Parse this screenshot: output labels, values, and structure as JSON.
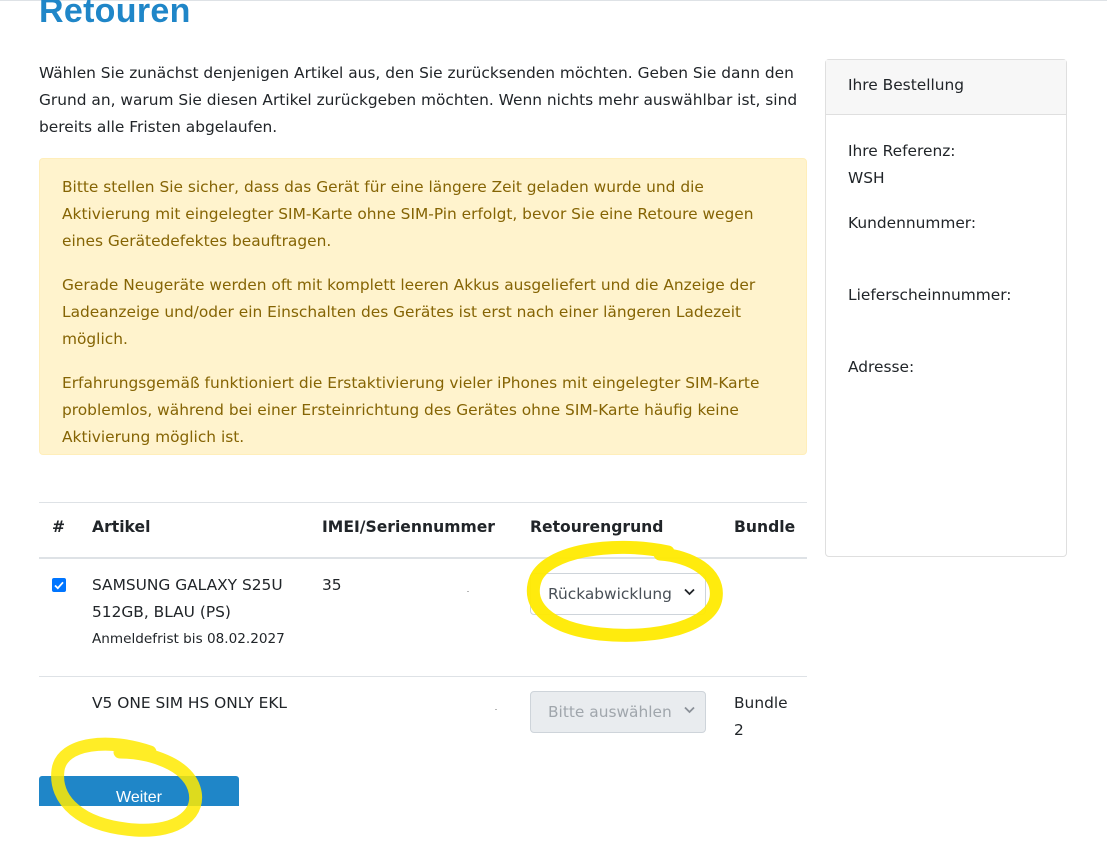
{
  "page": {
    "title": "Retouren",
    "intro": "Wählen Sie zunächst denjenigen Artikel aus, den Sie zurücksenden möchten. Geben Sie dann den Grund an, warum Sie diesen Artikel zurückgeben möchten. Wenn nichts mehr auswählbar ist, sind bereits alle Fristen abgelaufen."
  },
  "notice": {
    "paragraphs": [
      "Bitte stellen Sie sicher, dass das Gerät für eine längere Zeit geladen wurde und die Aktivierung mit eingelegter SIM-Karte ohne SIM-Pin erfolgt, bevor Sie eine Retoure wegen eines Gerätedefektes beauftragen.",
      "Gerade Neugeräte werden oft mit komplett leeren Akkus ausgeliefert und die Anzeige der Ladeanzeige und/oder ein Einschalten des Gerätes ist erst nach einer längeren Ladezeit möglich.",
      "Erfahrungsgemäß funktioniert die Erstaktivierung vieler iPhones mit eingelegter SIM-Karte problemlos, während bei einer Ersteinrichtung des Gerätes ohne SIM-Karte häufig keine Aktivierung möglich ist."
    ]
  },
  "table": {
    "headers": [
      "#",
      "Artikel",
      "IMEI/Seriennummer",
      "Retourengrund",
      "Bundle"
    ],
    "rows": [
      {
        "checked": true,
        "artikel_line1": "SAMSUNG GALAXY S25U",
        "artikel_line2": "512GB, BLAU (PS)",
        "deadline": "Anmeldefrist bis 08.02.2027",
        "imei": "35",
        "reason": "Rückabwicklung",
        "bundle": ""
      },
      {
        "checked": false,
        "artikel_line1": "V5 ONE SIM HS ONLY EKL",
        "artikel_line2": "",
        "deadline": "",
        "imei": "",
        "reason": "Bitte auswählen",
        "bundle_line1": "Bundle",
        "bundle_line2": "2"
      }
    ]
  },
  "sidebar": {
    "title": "Ihre Bestellung",
    "reference_label": "Ihre Referenz:",
    "reference_value": "WSH",
    "customer_label": "Kundennummer:",
    "delivery_label": "Lieferscheinnummer:",
    "address_label": "Adresse:"
  },
  "actions": {
    "next_label": "Weiter"
  },
  "colors": {
    "accent": "#1f86c8",
    "alert_bg": "#fff3cd",
    "alert_text": "#856404",
    "highlight": "#ffea00"
  },
  "icons": [
    "checkbox-checked-icon",
    "chevron-down-icon"
  ]
}
